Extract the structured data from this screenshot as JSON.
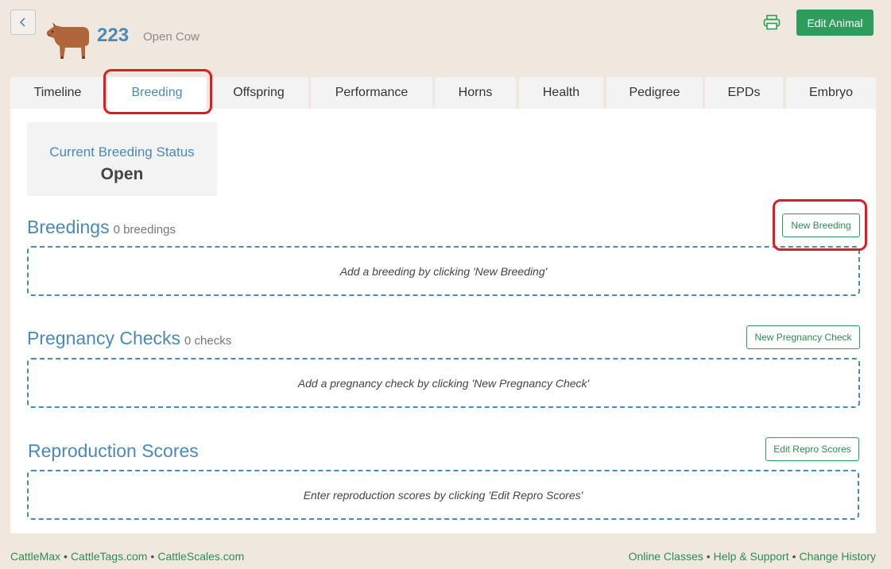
{
  "header": {
    "animal_id": "223",
    "animal_status": "Open Cow",
    "edit_button": "Edit Animal"
  },
  "tabs": [
    "Timeline",
    "Breeding",
    "Offspring",
    "Performance",
    "Horns",
    "Health",
    "Pedigree",
    "EPDs",
    "Embryo"
  ],
  "active_tab": "Breeding",
  "status_card": {
    "label": "Current Breeding Status",
    "value": "Open"
  },
  "breedings": {
    "title": "Breedings",
    "count": "0 breedings",
    "button": "New Breeding",
    "empty": "Add a breeding by clicking 'New Breeding'"
  },
  "pregnancy": {
    "title": "Pregnancy Checks",
    "count": "0 checks",
    "button": "New Pregnancy Check",
    "empty": "Add a pregnancy check by clicking 'New Pregnancy Check'"
  },
  "repro": {
    "title": "Reproduction Scores",
    "button": "Edit Repro Scores",
    "empty": "Enter reproduction scores by clicking 'Edit Repro Scores'"
  },
  "footer": {
    "left": [
      "CattleMax",
      "CattleTags.com",
      "CattleScales.com"
    ],
    "right": [
      "Online Classes",
      "Help & Support",
      "Change History"
    ]
  },
  "colors": {
    "brand_green": "#2e9c5a",
    "link_blue": "#4a8ab8",
    "highlight_red": "#e01b22",
    "page_bg": "#f0e8de"
  }
}
